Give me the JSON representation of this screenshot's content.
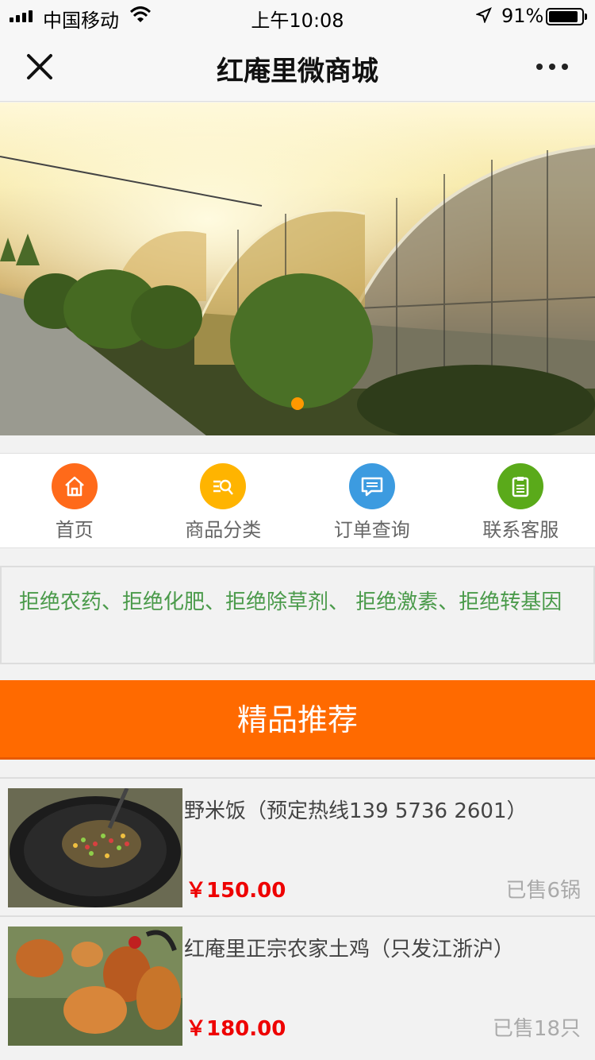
{
  "status_bar": {
    "carrier": "中国移动",
    "time": "上午10:08",
    "battery_percent": "91%",
    "battery_level": 0.91
  },
  "nav": {
    "title": "红庵里微商城",
    "close_icon": "close-icon",
    "more_icon": "more-dots-icon"
  },
  "banner": {
    "slide_count": 1,
    "active_index": 0,
    "indicator_color": "#ff9800"
  },
  "quick_nav": [
    {
      "label": "首页",
      "icon": "home-icon",
      "color": "#ff6a1a"
    },
    {
      "label": "商品分类",
      "icon": "category-search-icon",
      "color": "#ffb400"
    },
    {
      "label": "订单查询",
      "icon": "order-message-icon",
      "color": "#3c9be0"
    },
    {
      "label": "联系客服",
      "icon": "clipboard-icon",
      "color": "#5aaa1a"
    }
  ],
  "slogan": "拒绝农药、拒绝化肥、拒绝除草剂、 拒绝激素、拒绝转基因",
  "section": {
    "title": "精品推荐",
    "color": "#ff6a00"
  },
  "products": [
    {
      "name": "野米饭（预定热线139 5736 2601）",
      "price": "￥150.00",
      "sold": "已售6锅"
    },
    {
      "name": "红庵里正宗农家土鸡（只发江浙沪）",
      "price": "￥180.00",
      "sold": "已售18只"
    }
  ]
}
